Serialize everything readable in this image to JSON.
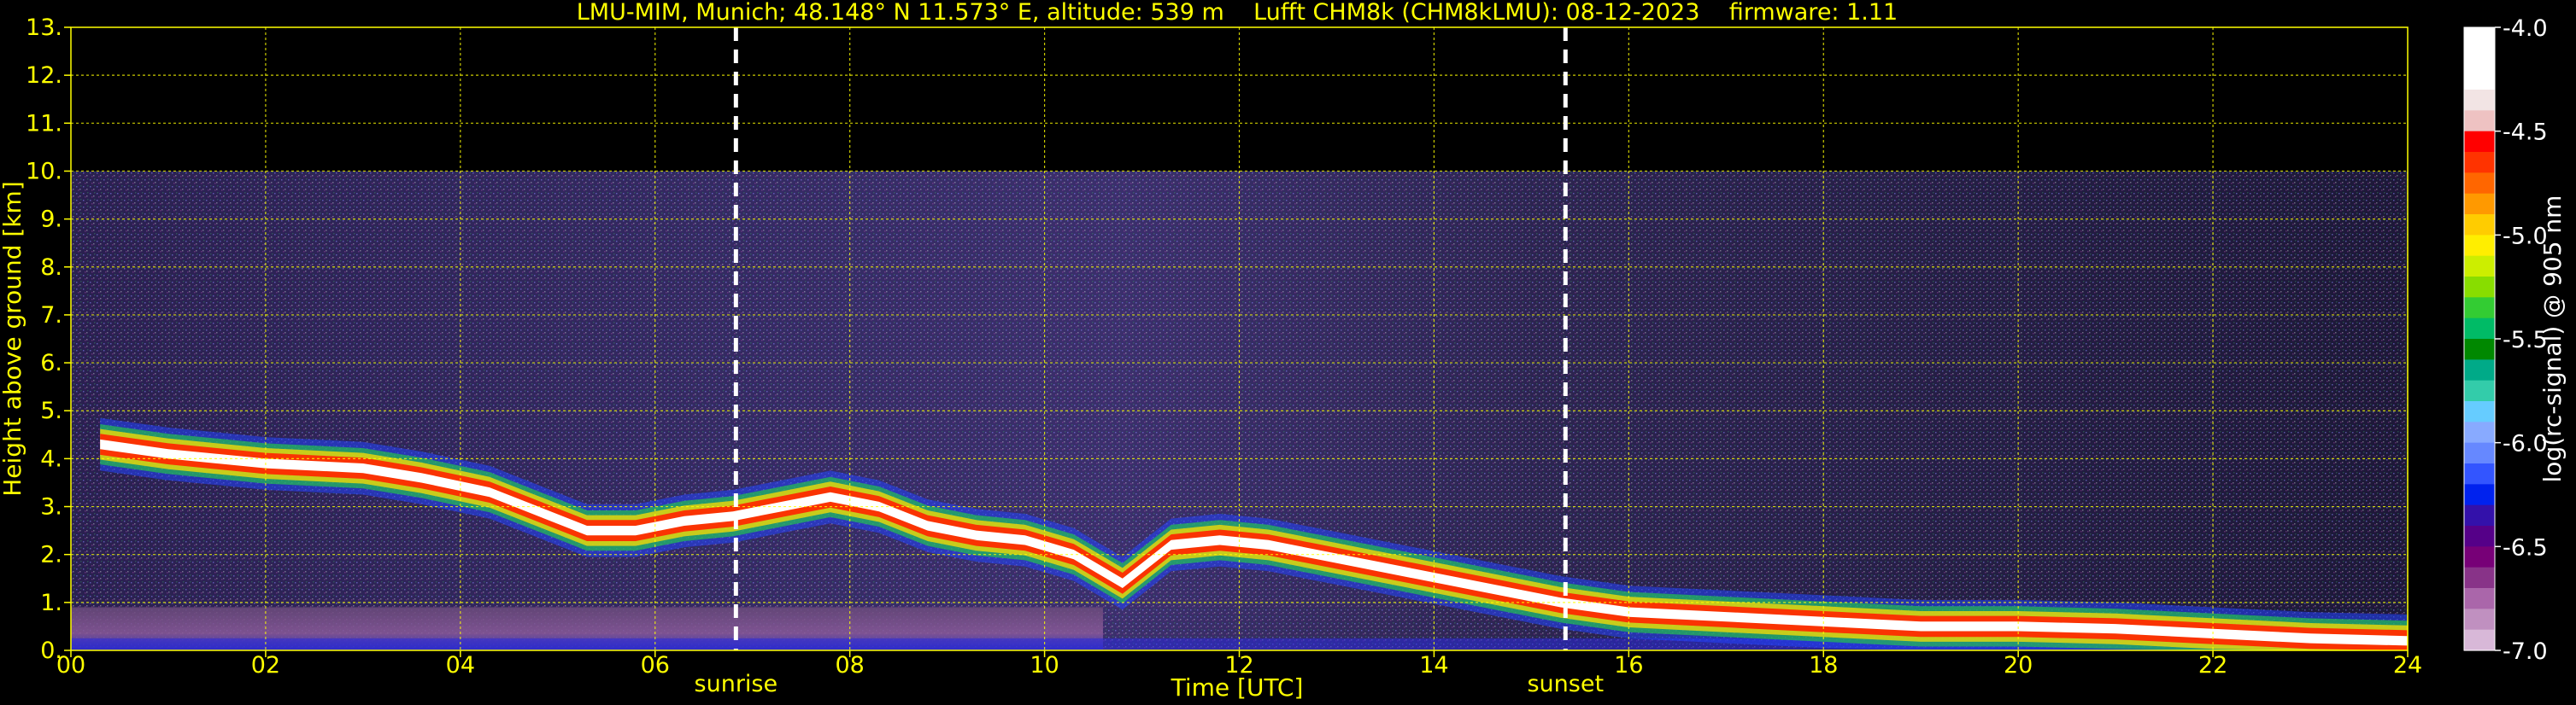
{
  "chart_data": {
    "type": "heatmap",
    "title": "LMU-MIM, Munich; 48.148° N 11.573° E, altitude: 539 m    Lufft CHM8k (CHM8kLMU): 08-12-2023    firmware: 1.11",
    "xlabel": "Time [UTC]",
    "ylabel": "Height above ground [km]",
    "xlim": [
      0,
      24
    ],
    "ylim": [
      0,
      13
    ],
    "x_ticks": [
      "00",
      "02",
      "04",
      "06",
      "08",
      "10",
      "12",
      "14",
      "16",
      "18",
      "20",
      "22",
      "24"
    ],
    "y_ticks": [
      "0.",
      "1.",
      "2.",
      "3.",
      "4.",
      "5.",
      "6.",
      "7.",
      "8.",
      "9.",
      "10.",
      "11.",
      "12.",
      "13."
    ],
    "grid": true,
    "measurement_top_km": 10,
    "markers": [
      {
        "label": "sunrise",
        "time_h": 6.83
      },
      {
        "label": "sunset",
        "time_h": 15.35
      }
    ],
    "cloud_layer": [
      [
        0.3,
        4.3
      ],
      [
        1.0,
        4.1
      ],
      [
        2.0,
        3.9
      ],
      [
        3.0,
        3.8
      ],
      [
        3.6,
        3.6
      ],
      [
        4.3,
        3.3
      ],
      [
        4.8,
        2.9
      ],
      [
        5.3,
        2.5
      ],
      [
        5.8,
        2.5
      ],
      [
        6.3,
        2.7
      ],
      [
        6.8,
        2.8
      ],
      [
        7.3,
        3.0
      ],
      [
        7.8,
        3.2
      ],
      [
        8.3,
        3.0
      ],
      [
        8.8,
        2.6
      ],
      [
        9.3,
        2.4
      ],
      [
        9.8,
        2.3
      ],
      [
        10.3,
        2.0
      ],
      [
        10.8,
        1.4
      ],
      [
        11.3,
        2.2
      ],
      [
        11.8,
        2.3
      ],
      [
        12.3,
        2.2
      ],
      [
        12.8,
        2.0
      ],
      [
        13.3,
        1.8
      ],
      [
        13.8,
        1.6
      ],
      [
        14.3,
        1.4
      ],
      [
        14.8,
        1.2
      ],
      [
        15.3,
        1.0
      ],
      [
        16.0,
        0.8
      ],
      [
        17.0,
        0.7
      ],
      [
        18.0,
        0.6
      ],
      [
        19.0,
        0.5
      ],
      [
        20.0,
        0.5
      ],
      [
        21.0,
        0.45
      ],
      [
        22.0,
        0.35
      ],
      [
        23.0,
        0.25
      ],
      [
        24.0,
        0.2
      ]
    ],
    "colorbar": {
      "label": "log(rc-signal) @ 905 nm",
      "range": [
        -7.0,
        -4.0
      ],
      "ticks": [
        "-4.0",
        "-4.5",
        "-5.0",
        "-5.5",
        "-6.0",
        "-6.5",
        "-7.0"
      ],
      "colors": [
        "#ffffff",
        "#ffffff",
        "#ffffff",
        "#f2e4e4",
        "#eec2c2",
        "#ff0000",
        "#ff3300",
        "#ff6600",
        "#ff9900",
        "#ffcc00",
        "#ffee00",
        "#ccee00",
        "#88dd00",
        "#33cc33",
        "#00bb66",
        "#008800",
        "#00aa88",
        "#33ccaa",
        "#66ccff",
        "#88aaff",
        "#6688ff",
        "#3355ff",
        "#0022ee",
        "#3311aa",
        "#550088",
        "#770077",
        "#883388",
        "#aa66aa",
        "#c090c0",
        "#d8b8d8"
      ]
    }
  }
}
